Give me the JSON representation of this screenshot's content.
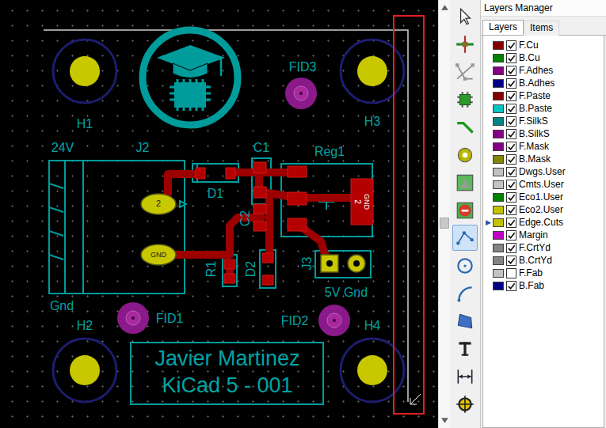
{
  "canvas": {
    "holes": [
      "H1",
      "H2",
      "H3",
      "H4"
    ],
    "fiducials": [
      "FID1",
      "FID2",
      "FID3"
    ],
    "silk_labels": [
      "24V",
      "J2",
      "C1",
      "Reg1",
      "D1",
      "C2",
      "R1",
      "D2",
      "J3",
      "5V Gnd",
      "Gnd"
    ],
    "pad_labels": [
      "2",
      "GND",
      "2",
      "GND"
    ],
    "title_block": [
      "Javier Martinez",
      "KiCad 5 - 001"
    ]
  },
  "scrollbar": {
    "level": 0.54
  },
  "toolbar": {
    "tools": [
      {
        "kind": "select",
        "selected": false
      },
      {
        "kind": "highlight",
        "selected": false
      },
      {
        "kind": "ratsnest",
        "selected": false
      },
      {
        "kind": "footprint",
        "selected": false
      },
      {
        "kind": "route",
        "selected": false
      },
      {
        "kind": "via",
        "selected": false
      },
      {
        "kind": "zone",
        "selected": false
      },
      {
        "kind": "keepout",
        "selected": false
      },
      {
        "kind": "line",
        "selected": true
      },
      {
        "kind": "circle",
        "selected": false
      },
      {
        "kind": "arc",
        "selected": false
      },
      {
        "kind": "polygon",
        "selected": false
      },
      {
        "kind": "text",
        "selected": false
      },
      {
        "kind": "dimension",
        "selected": false
      },
      {
        "kind": "target",
        "selected": false
      }
    ]
  },
  "layers_manager": {
    "title": "Layers Manager",
    "tabs": [
      {
        "label": "Layers",
        "selected": true
      },
      {
        "label": "Items",
        "selected": false
      }
    ],
    "active_marker": "▶",
    "layers": [
      {
        "name": "F.Cu",
        "color": "#840000",
        "checked": true,
        "selected": false
      },
      {
        "name": "B.Cu",
        "color": "#008400",
        "checked": true,
        "selected": false
      },
      {
        "name": "F.Adhes",
        "color": "#840084",
        "checked": true,
        "selected": false
      },
      {
        "name": "B.Adhes",
        "color": "#000084",
        "checked": true,
        "selected": false
      },
      {
        "name": "F.Paste",
        "color": "#840000",
        "checked": true,
        "selected": false
      },
      {
        "name": "B.Paste",
        "color": "#00c2c2",
        "checked": true,
        "selected": false
      },
      {
        "name": "F.SilkS",
        "color": "#008484",
        "checked": true,
        "selected": false
      },
      {
        "name": "B.SilkS",
        "color": "#840084",
        "checked": true,
        "selected": false
      },
      {
        "name": "F.Mask",
        "color": "#840084",
        "checked": true,
        "selected": false
      },
      {
        "name": "B.Mask",
        "color": "#848400",
        "checked": true,
        "selected": false
      },
      {
        "name": "Dwgs.User",
        "color": "#c2c2c2",
        "checked": true,
        "selected": false
      },
      {
        "name": "Cmts.User",
        "color": "#c2c2c2",
        "checked": true,
        "selected": false
      },
      {
        "name": "Eco1.User",
        "color": "#008400",
        "checked": true,
        "selected": false
      },
      {
        "name": "Eco2.User",
        "color": "#c2c200",
        "checked": true,
        "selected": false
      },
      {
        "name": "Edge.Cuts",
        "color": "#c2c200",
        "checked": true,
        "selected": true
      },
      {
        "name": "Margin",
        "color": "#c200c2",
        "checked": true,
        "selected": false
      },
      {
        "name": "F.CrtYd",
        "color": "#848484",
        "checked": true,
        "selected": false
      },
      {
        "name": "B.CrtYd",
        "color": "#848484",
        "checked": true,
        "selected": false
      },
      {
        "name": "F.Fab",
        "color": "#c2c2c2",
        "checked": false,
        "selected": false
      },
      {
        "name": "B.Fab",
        "color": "#000084",
        "checked": true,
        "selected": false
      }
    ]
  }
}
